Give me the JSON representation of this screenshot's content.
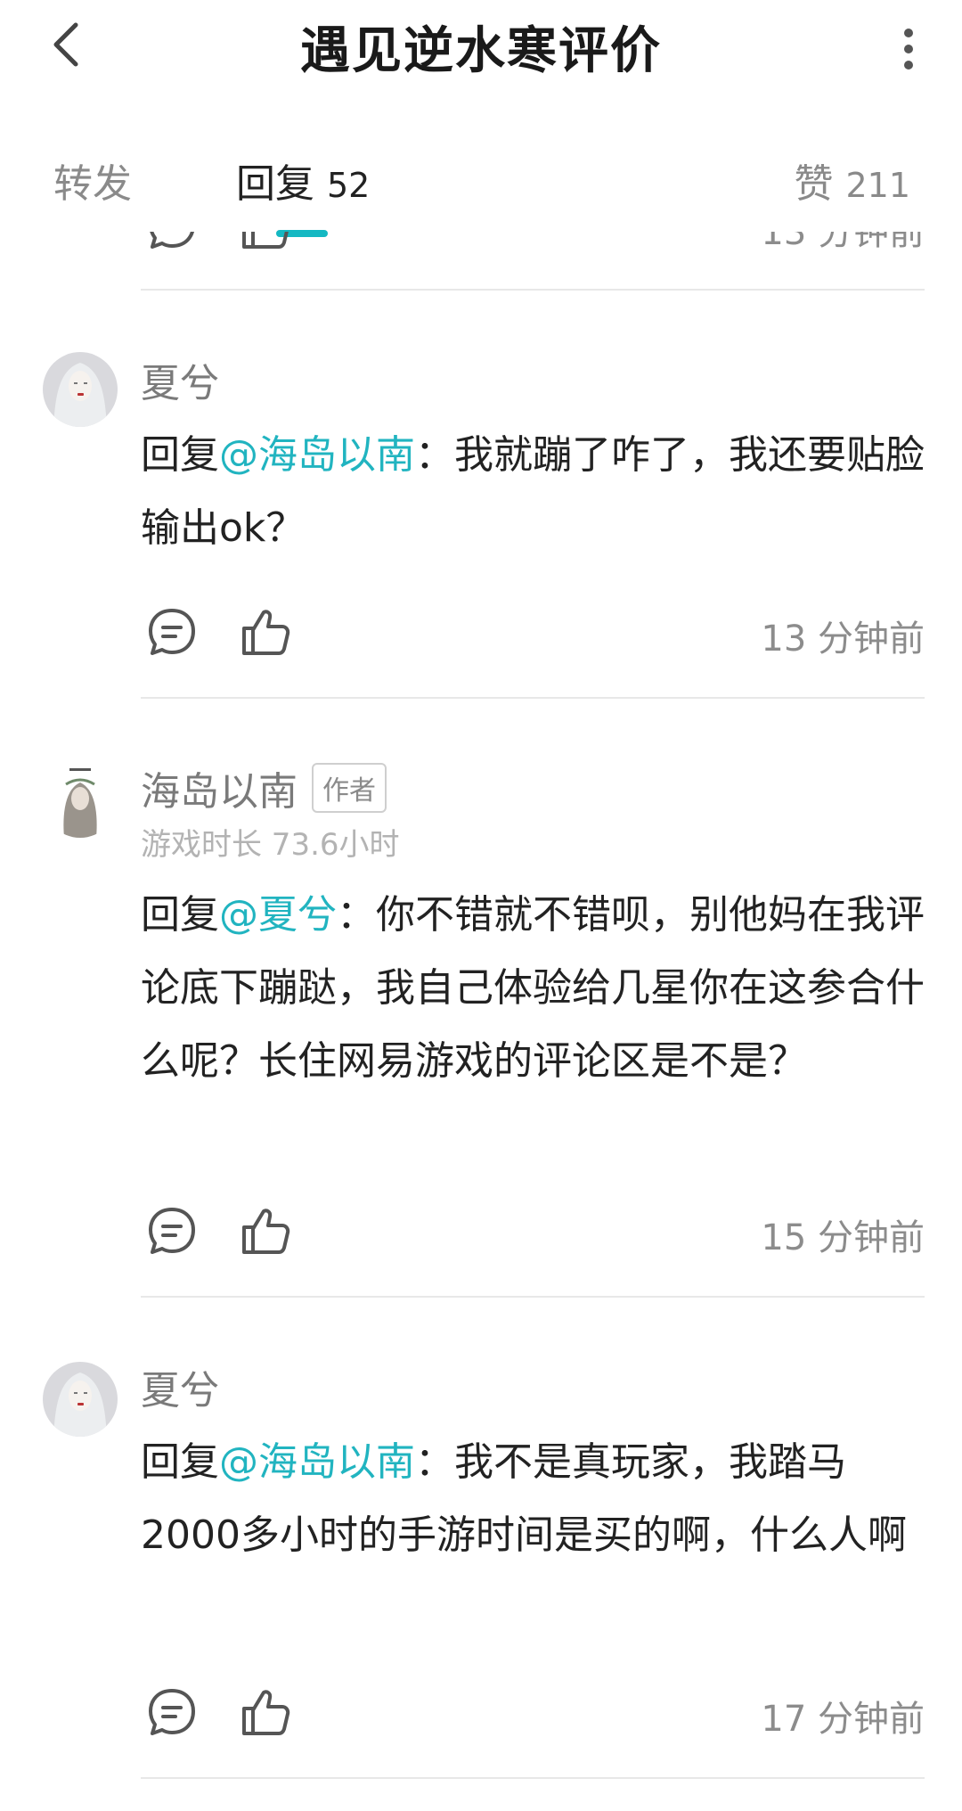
{
  "header": {
    "title": "遇见逆水寒评价"
  },
  "tabs": [
    {
      "label": "转发",
      "count": ""
    },
    {
      "label": "回复",
      "count": "52"
    },
    {
      "label": "赞",
      "count": "211"
    }
  ],
  "colors": {
    "accent": "#21b4c0",
    "indicator": "#14b8c2",
    "text": "#222222",
    "muted": "#8c8c8c"
  },
  "comments": [
    {
      "timestamp": "13 分钟前"
    },
    {
      "author": "夏兮",
      "reply_prefix": "回复",
      "mention": "@海岛以南",
      "text": "：我就蹦了咋了，我还要贴脸输出ok？",
      "timestamp": "13 分钟前"
    },
    {
      "author": "海岛以南",
      "badge": "作者",
      "playtime": "游戏时长 73.6小时",
      "reply_prefix": "回复",
      "mention": "@夏兮",
      "text": "：你不错就不错呗，别他妈在我评论底下蹦跶，我自己体验给几星你在这参合什么呢？长住网易游戏的评论区是不是？",
      "timestamp": "15 分钟前"
    },
    {
      "author": "夏兮",
      "reply_prefix": "回复",
      "mention": "@海岛以南",
      "text": "：我不是真玩家，我踏马2000多小时的手游时间是买的啊，什么人啊",
      "timestamp": "17 分钟前"
    }
  ],
  "icons": {
    "back": "chevron-left-icon",
    "more": "more-vertical-icon",
    "reply": "comment-bubble-icon",
    "like": "thumbs-up-icon"
  }
}
